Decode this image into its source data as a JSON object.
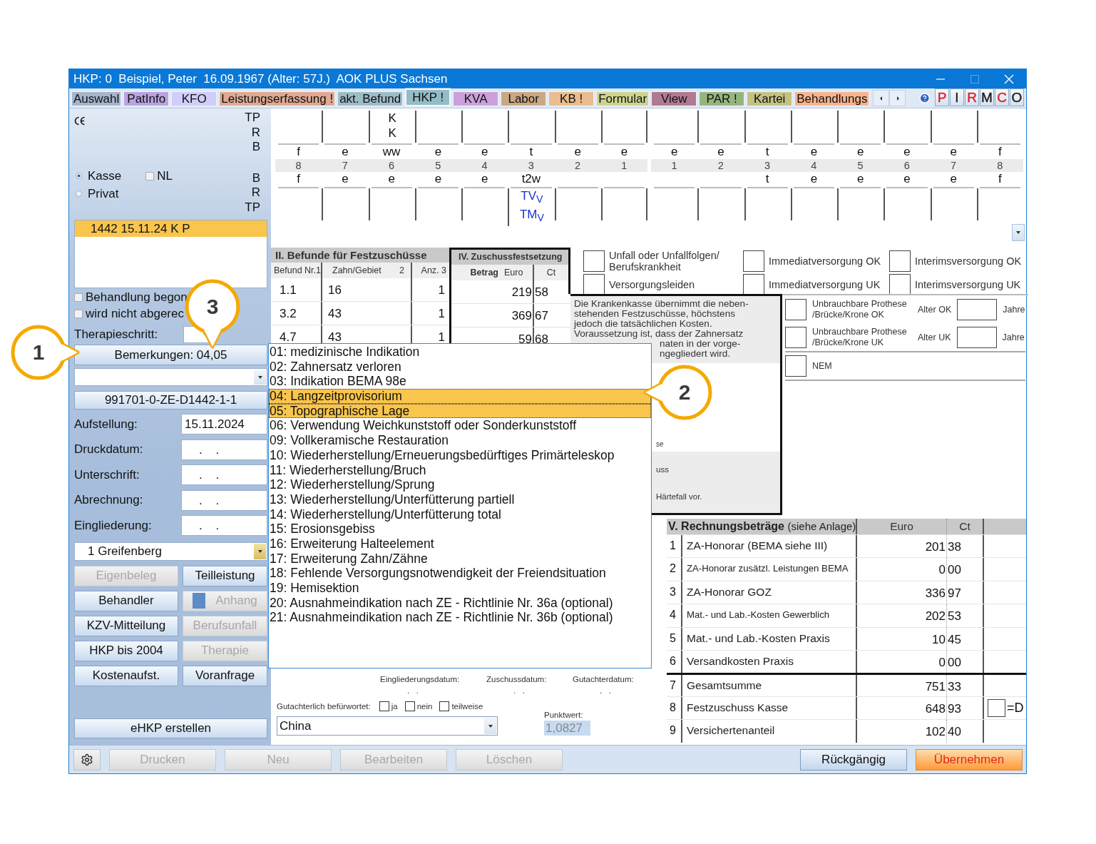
{
  "window": {
    "title": "HKP: 0  Beispiel, Peter  16.09.1967 (Alter: 57J.)  AOK PLUS Sachsen"
  },
  "tabs": [
    {
      "label": "Auswahl",
      "color": "#a6b4cc",
      "selected": false
    },
    {
      "label": "PatInfo",
      "color": "#b9a3e0",
      "selected": false
    },
    {
      "label": "KFO",
      "color": "#d0cdfa",
      "selected": false
    },
    {
      "label": "Leistungserfassung !",
      "color": "#dfa994",
      "selected": false
    },
    {
      "label": "akt. Befund",
      "color": "#9dbcc6",
      "selected": false
    },
    {
      "label": "HKP !",
      "color": "#94bcc7",
      "selected": true
    },
    {
      "label": "KVA",
      "color": "#cca0dc",
      "selected": false
    },
    {
      "label": "Labor",
      "color": "#c9a883",
      "selected": false
    },
    {
      "label": "KB !",
      "color": "#e9bd8e",
      "selected": false
    },
    {
      "label": "Formular",
      "color": "#cdd48f",
      "selected": false
    },
    {
      "label": "View",
      "color": "#b27a92",
      "selected": false
    },
    {
      "label": "PAR !",
      "color": "#96b57e",
      "selected": false
    },
    {
      "label": "Kartei",
      "color": "#c3c283",
      "selected": false
    },
    {
      "label": "Behandlungs",
      "color": "#f7b48e",
      "selected": false
    }
  ],
  "quick_buttons": [
    {
      "label": "P",
      "color": "#e0202a"
    },
    {
      "label": "I",
      "color": "#222222"
    },
    {
      "label": "R",
      "color": "#e0202a"
    },
    {
      "label": "M",
      "color": "#222222"
    },
    {
      "label": "C",
      "color": "#e0202a"
    },
    {
      "label": "O",
      "color": "#222222"
    }
  ],
  "left_panel": {
    "upper_jaw_labels": [
      "TP",
      "R",
      "B"
    ],
    "lower_jaw_labels": [
      "B",
      "R",
      "TP"
    ],
    "insurance": [
      {
        "label": "Kasse",
        "selected": true
      },
      {
        "label": "Privat",
        "selected": false
      }
    ],
    "nl": {
      "label": "NL",
      "checked": false
    },
    "plans": [
      {
        "label": "1442 15.11.24 K P",
        "selected": true
      }
    ],
    "flags": [
      {
        "label": "Behandlung begon",
        "checked": false
      },
      {
        "label": "wird nicht abgerec",
        "checked": false
      }
    ],
    "therapy_step": {
      "label": "Therapieschritt:"
    },
    "remarks_button": "Bemerkungen: 04,05",
    "plan_number_button": "991701-0-ZE-D1442-1-1",
    "dates": [
      {
        "label": "Aufstellung:",
        "value": "15.11.2024"
      },
      {
        "label": "Druckdatum:",
        "value": ".    ."
      },
      {
        "label": "Unterschrift:",
        "value": ".    ."
      },
      {
        "label": "Abrechnung:",
        "value": ".    ."
      },
      {
        "label": "Eingliederung:",
        "value": ".    ."
      }
    ],
    "location": "1 Greifenberg",
    "buttons": [
      {
        "label": "Eigenbeleg",
        "disabled": true
      },
      {
        "label": "Teilleistung",
        "disabled": false
      },
      {
        "label": "Behandler",
        "disabled": false
      },
      {
        "label": "Anhang",
        "disabled": true,
        "marker": true
      },
      {
        "label": "KZV-Mitteilung",
        "disabled": false
      },
      {
        "label": "Berufsunfall",
        "disabled": true
      },
      {
        "label": "HKP bis 2004",
        "disabled": false
      },
      {
        "label": "Therapie",
        "disabled": true
      },
      {
        "label": "Kostenaufst.",
        "disabled": false
      },
      {
        "label": "Voranfrage",
        "disabled": false
      }
    ],
    "ehkp_button": "eHKP erstellen"
  },
  "tooth_chart": {
    "columns": [
      {
        "upper": "f",
        "number": "8",
        "lower": "f"
      },
      {
        "upper": "e",
        "number": "7",
        "lower": "e"
      },
      {
        "top": [
          "K",
          "K"
        ],
        "upper": "ww",
        "number": "6",
        "lower": "e"
      },
      {
        "upper": "e",
        "number": "5",
        "lower": "e"
      },
      {
        "upper": "e",
        "number": "4",
        "lower": "e"
      },
      {
        "upper": "t",
        "number": "3",
        "lower": "t2w",
        "bottom": [
          "TV$_{V}$",
          "TM$_{V}$"
        ]
      },
      {
        "upper": "e",
        "number": "2"
      },
      {
        "upper": "e",
        "number": "1"
      },
      {
        "upper": "e",
        "number": "1"
      },
      {
        "upper": "e",
        "number": "2"
      },
      {
        "upper": "t",
        "number": "3",
        "lower": "t"
      },
      {
        "upper": "e",
        "number": "4",
        "lower": "e"
      },
      {
        "upper": "e",
        "number": "5",
        "lower": "e"
      },
      {
        "upper": "e",
        "number": "6",
        "lower": "e"
      },
      {
        "upper": "e",
        "number": "7",
        "lower": "e"
      },
      {
        "upper": "f",
        "number": "8",
        "lower": "f"
      }
    ]
  },
  "befunde": {
    "title": "II. Befunde für Festzuschüsse",
    "columns": [
      "Befund Nr.1",
      "Zahn/Gebiet",
      "2",
      "Anz. 3"
    ],
    "rows": [
      {
        "befund": "1.1",
        "zahn": "16",
        "anzahl": "1"
      },
      {
        "befund": "3.2",
        "zahn": "43",
        "anzahl": "1"
      },
      {
        "befund": "4.7",
        "zahn": "43",
        "anzahl": "1"
      }
    ]
  },
  "zuschuss": {
    "title": "IV. Zuschussfestsetzung",
    "columns": [
      "Betrag",
      "Euro",
      "Ct"
    ],
    "rows": [
      {
        "euro": "219",
        "ct": "58"
      },
      {
        "euro": "369",
        "ct": "67"
      },
      {
        "euro": "59",
        "ct": "68"
      }
    ]
  },
  "conditions": [
    {
      "label": "Unfall oder Unfallfolgen/ Berufskrankheit",
      "checked": false
    },
    {
      "label": "Immediatversorgung OK",
      "checked": false
    },
    {
      "label": "Interimsversorgung OK",
      "checked": false
    },
    {
      "label": "Versorgungsleiden",
      "checked": false
    },
    {
      "label": "Immediatversorgung UK",
      "checked": false
    },
    {
      "label": "Interimsversorgung UK",
      "checked": false
    }
  ],
  "notice": {
    "text": "Die Krankenkasse übernimmt die neben-\nstehenden Festzuschüsse, höchstens\njedoch die tatsächlichen Kosten.\nVoraussetzung ist, dass der Zahnersatz",
    "fragments": [
      "naten in der vorge-",
      "ngegliedert wird."
    ],
    "lower_fragments": [
      "se",
      "uss",
      "Härtefall vor."
    ]
  },
  "prosthesis": [
    {
      "label": "Unbrauchbare Prothese /Brücke/Krone OK",
      "age_label": "Alter OK",
      "unit": "Jahre",
      "checked": false
    },
    {
      "label": "Unbrauchbare Prothese /Brücke/Krone UK",
      "age_label": "Alter UK",
      "unit": "Jahre",
      "checked": false
    }
  ],
  "nem": {
    "label": "NEM",
    "checked": false
  },
  "remarks_dropdown": {
    "items": [
      {
        "label": "01: medizinische Indikation",
        "selected": false
      },
      {
        "label": "02: Zahnersatz verloren",
        "selected": false
      },
      {
        "label": "03: Indikation BEMA 98e",
        "selected": false
      },
      {
        "label": "04: Langzeitprovisorium",
        "selected": true
      },
      {
        "label": "05: Topographische Lage",
        "selected": true
      },
      {
        "label": "06: Verwendung Weichkunststoff oder Sonderkunststoff",
        "selected": false
      },
      {
        "label": "09: Vollkeramische Restauration",
        "selected": false
      },
      {
        "label": "10: Wiederherstellung/Erneuerungsbedürftiges Primärteleskop",
        "selected": false
      },
      {
        "label": "11: Wiederherstellung/Bruch",
        "selected": false
      },
      {
        "label": "12: Wiederherstellung/Sprung",
        "selected": false
      },
      {
        "label": "13: Wiederherstellung/Unterfütterung partiell",
        "selected": false
      },
      {
        "label": "14: Wiederherstellung/Unterfütterung total",
        "selected": false
      },
      {
        "label": "15: Erosionsgebiss",
        "selected": false
      },
      {
        "label": "16: Erweiterung Halteelement",
        "selected": false
      },
      {
        "label": "17: Erweiterung Zahn/Zähne",
        "selected": false
      },
      {
        "label": "18: Fehlende Versorgungsnotwendigkeit der Freiendsituation",
        "selected": false
      },
      {
        "label": "19: Hemisektion",
        "selected": false
      },
      {
        "label": "20: Ausnahmeindikation nach ZE - Richtlinie Nr. 36a (optional)",
        "selected": false
      },
      {
        "label": "21: Ausnahmeindikation nach ZE - Richtlinie Nr. 36b (optional)",
        "selected": false
      }
    ]
  },
  "footer_dates": [
    {
      "label": "Eingliederungsdatum:",
      "value": ".   ."
    },
    {
      "label": "Zuschussdatum:",
      "value": ".   ."
    },
    {
      "label": "Gutachterdatum:",
      "value": ".   ."
    }
  ],
  "expert": {
    "label": "Gutachterlich befürwortet:",
    "options": [
      {
        "label": "ja",
        "checked": false
      },
      {
        "label": "nein",
        "checked": false
      },
      {
        "label": "teilweise",
        "checked": false
      }
    ]
  },
  "country": "China",
  "punktwert": {
    "label": "Punktwert:",
    "value": "1,0827"
  },
  "rechnung": {
    "title": "V. Rechnungsbeträge",
    "subtitle": "(siehe Anlage)",
    "columns": [
      "Euro",
      "Ct"
    ],
    "rows": [
      {
        "number": "1",
        "label": "ZA-Honorar (BEMA siehe III)",
        "euro": "201",
        "ct": "38",
        "kind": "item"
      },
      {
        "number": "2",
        "label": "ZA-Honorar zusätzl. Leistungen BEMA",
        "euro": "0",
        "ct": "00",
        "kind": "item"
      },
      {
        "number": "3",
        "label": "ZA-Honorar GOZ",
        "euro": "336",
        "ct": "97",
        "kind": "item"
      },
      {
        "number": "4",
        "label": "Mat.- und Lab.-Kosten Gewerblich",
        "euro": "202",
        "ct": "53",
        "kind": "item"
      },
      {
        "number": "5",
        "label": "Mat.- und Lab.-Kosten Praxis",
        "euro": "10",
        "ct": "45",
        "kind": "item"
      },
      {
        "number": "6",
        "label": "Versandkosten Praxis",
        "euro": "0",
        "ct": "00",
        "kind": "item"
      },
      {
        "number": "7",
        "label": "Gesamtsumme",
        "euro": "751",
        "ct": "33",
        "kind": "sum"
      },
      {
        "number": "8",
        "label": "Festzuschuss Kasse",
        "euro": "648",
        "ct": "93",
        "kind": "sum",
        "direct": {
          "label": "=D",
          "checked": false
        }
      },
      {
        "number": "9",
        "label": "Versichertenanteil",
        "euro": "102",
        "ct": "40",
        "kind": "sum"
      }
    ]
  },
  "bottom_buttons": [
    {
      "label": "Drucken",
      "disabled": true
    },
    {
      "label": "Neu",
      "disabled": true
    },
    {
      "label": "Bearbeiten",
      "disabled": true
    },
    {
      "label": "Löschen",
      "disabled": true
    }
  ],
  "action_buttons": [
    {
      "label": "Rückgängig",
      "kind": "normal"
    },
    {
      "label": "Übernehmen",
      "kind": "primary"
    }
  ],
  "callouts": [
    {
      "label": "1"
    },
    {
      "label": "2"
    },
    {
      "label": "3"
    }
  ]
}
